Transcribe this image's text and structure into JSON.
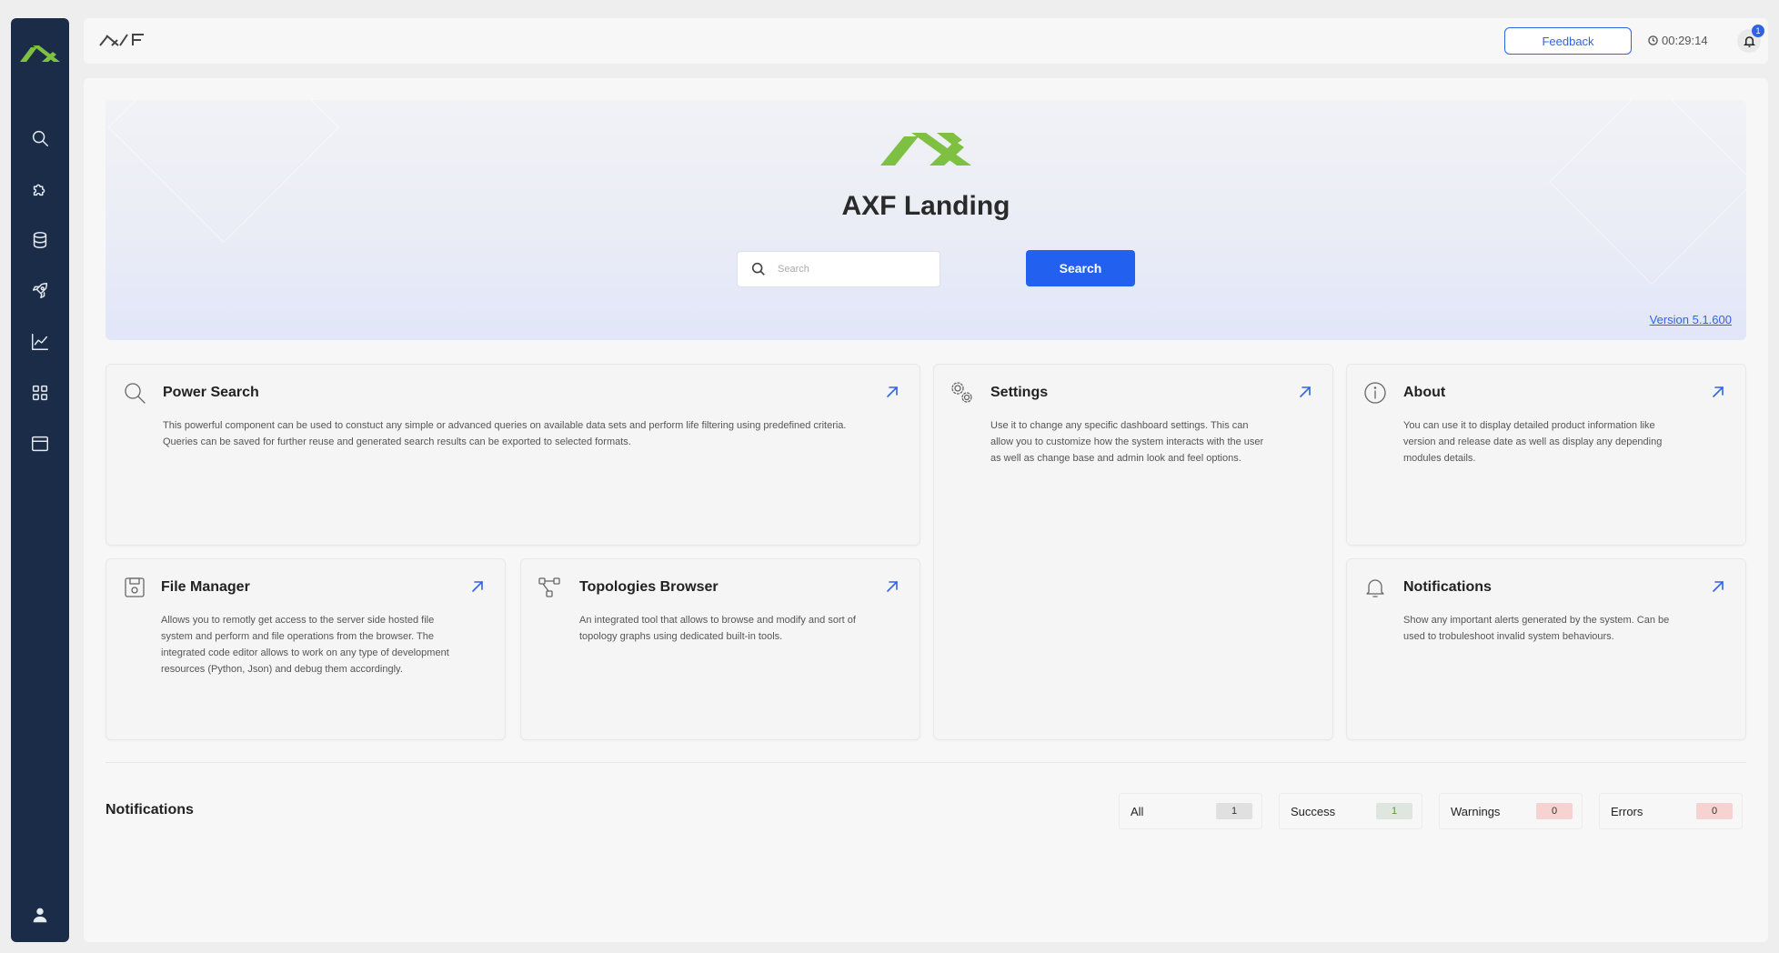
{
  "topbar": {
    "brand": "AXF",
    "feedback_label": "Feedback",
    "timer": "00:29:14",
    "notification_count": "1"
  },
  "sidebar": {
    "items": [
      {
        "name": "search",
        "icon": "search-icon"
      },
      {
        "name": "plugins",
        "icon": "puzzle-icon"
      },
      {
        "name": "database",
        "icon": "database-icon"
      },
      {
        "name": "deploy",
        "icon": "rocket-icon"
      },
      {
        "name": "analytics",
        "icon": "chart-line-icon"
      },
      {
        "name": "modules",
        "icon": "grid-icon"
      },
      {
        "name": "browser",
        "icon": "window-icon"
      }
    ],
    "user_icon": "user-icon"
  },
  "hero": {
    "title": "AXF Landing",
    "search_placeholder": "Search",
    "search_button": "Search",
    "version": "Version 5.1.600"
  },
  "cards": {
    "power_search": {
      "title": "Power Search",
      "desc": "This powerful component can be used to constuct any simple or advanced queries on available data sets and perform life filtering using predefined criteria. Queries can be saved for further reuse and generated search results can be exported to selected formats."
    },
    "settings": {
      "title": "Settings",
      "desc": "Use it to change any specific dashboard settings. This can allow you to customize how the system interacts with the user as well as change base and admin look and feel options."
    },
    "about": {
      "title": "About",
      "desc": "You can use it to display detailed product information like version and release date as well as display any depending modules details."
    },
    "file_manager": {
      "title": "File Manager",
      "desc": "Allows you to remotly get access to the server side hosted file system and perform and file operations from the browser. The integrated code editor allows to work on any type of development resources (Python, Json) and debug them accordingly."
    },
    "topologies": {
      "title": "Topologies Browser",
      "desc": "An integrated tool that allows to browse and modify and sort of topology graphs using dedicated built-in tools."
    },
    "notifications": {
      "title": "Notifications",
      "desc": "Show any important alerts generated by the system. Can be used to trobuleshoot invalid system behaviours."
    }
  },
  "notifications_section": {
    "title": "Notifications",
    "filters": [
      {
        "label": "All",
        "count": "1",
        "color": "#e0e0e0"
      },
      {
        "label": "Success",
        "count": "1",
        "color": "#dfe6df"
      },
      {
        "label": "Warnings",
        "count": "0",
        "color": "#f6d2d0"
      },
      {
        "label": "Errors",
        "count": "0",
        "color": "#f6d2d0"
      }
    ]
  },
  "colors": {
    "accent": "#2260f0",
    "brand_green": "#7ec142",
    "sidebar": "#1b2c48"
  }
}
